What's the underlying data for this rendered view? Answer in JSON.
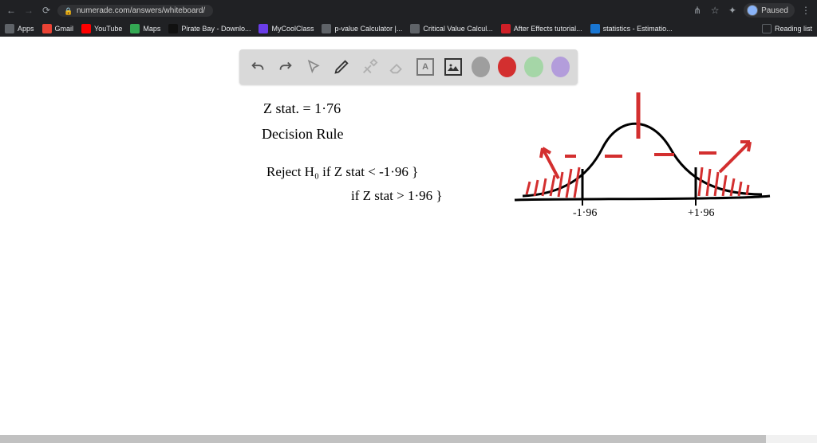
{
  "browser": {
    "url": "numerade.com/answers/whiteboard/",
    "profile_label": "Paused",
    "reading_list_label": "Reading list"
  },
  "bookmarks": [
    {
      "key": "apps",
      "label": "Apps",
      "favClass": "fav-apps"
    },
    {
      "key": "gmail",
      "label": "Gmail",
      "favClass": "fav-gmail"
    },
    {
      "key": "youtube",
      "label": "YouTube",
      "favClass": "fav-yt"
    },
    {
      "key": "maps",
      "label": "Maps",
      "favClass": "fav-maps"
    },
    {
      "key": "piratebay",
      "label": "Pirate Bay - Downlo...",
      "favClass": "fav-pb"
    },
    {
      "key": "mycoolclass",
      "label": "MyCoolClass",
      "favClass": "fav-mcc"
    },
    {
      "key": "pvalue",
      "label": "p-value Calculator |...",
      "favClass": "fav-pv"
    },
    {
      "key": "critval",
      "label": "Critical Value Calcul...",
      "favClass": "fav-cv"
    },
    {
      "key": "ae",
      "label": "After Effects tutorial...",
      "favClass": "fav-ae"
    },
    {
      "key": "stats",
      "label": "statistics - Estimatio...",
      "favClass": "fav-stats"
    }
  ],
  "toolbar": {
    "undo": "undo",
    "redo": "redo",
    "pointer": "pointer",
    "pencil": "pencil",
    "tools": "tools",
    "eraser": "eraser",
    "text_label": "A",
    "image": "image",
    "colors": [
      "#9e9e9e",
      "#d32f2f",
      "#a5d6a7",
      "#b39ddb"
    ],
    "active_color": "#d32f2f"
  },
  "whiteboard": {
    "line1": "Z stat. = 1·76",
    "line2": "Decision Rule",
    "line3": "Reject H₀ if  Z stat < -1·96 }",
    "line3b": "if Z stat > 1·96 }",
    "axis_labels": {
      "left": "-1·96",
      "right": "+1·96"
    }
  }
}
